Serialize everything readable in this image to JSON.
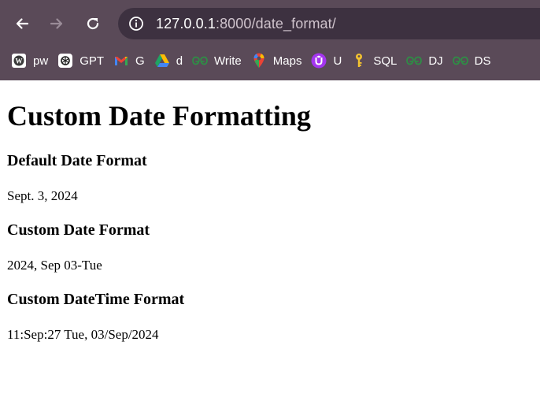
{
  "browser": {
    "url_host": "127.0.0.1",
    "url_rest": ":8000/date_format/",
    "bookmarks": [
      {
        "label": "pw",
        "icon": "wordpress-icon"
      },
      {
        "label": "GPT",
        "icon": "openai-icon"
      },
      {
        "label": "G",
        "icon": "gmail-icon"
      },
      {
        "label": "d",
        "icon": "google-drive-icon"
      },
      {
        "label": "Write",
        "icon": "geeksforgeeks-icon"
      },
      {
        "label": "Maps",
        "icon": "google-maps-icon"
      },
      {
        "label": "U",
        "icon": "u-app-icon"
      },
      {
        "label": "SQL",
        "icon": "key-icon"
      },
      {
        "label": "DJ",
        "icon": "geeksforgeeks-icon"
      },
      {
        "label": "DS",
        "icon": "geeksforgeeks-icon"
      }
    ]
  },
  "page": {
    "title": "Custom Date Formatting",
    "sections": [
      {
        "heading": "Default Date Format",
        "value": "Sept. 3, 2024"
      },
      {
        "heading": "Custom Date Format",
        "value": "2024, Sep 03-Tue"
      },
      {
        "heading": "Custom DateTime Format",
        "value": "11:Sep:27 Tue, 03/Sep/2024"
      }
    ]
  },
  "colors": {
    "chrome_bg": "#5a4a58",
    "omnibox_bg": "#3d3140",
    "gfg_green": "#2f8d46"
  }
}
